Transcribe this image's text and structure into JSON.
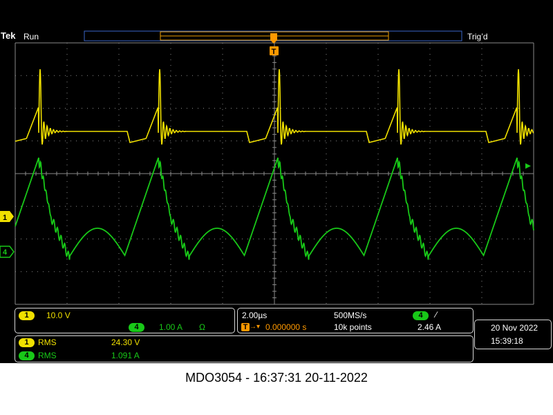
{
  "header": {
    "brand": "Tek",
    "state": "Run",
    "trigger_status": "Trig’d",
    "trigger_marker": "T"
  },
  "channels": {
    "ch1": {
      "number": "1",
      "color": "#f0e000"
    },
    "ch4": {
      "number": "4",
      "color": "#18c818"
    }
  },
  "readouts": {
    "ch1_scale": "10.0 V",
    "ch4_scale": "1.00 A",
    "ch4_unit_symbol": "Ω",
    "timebase": "2.00µs",
    "sample_rate": "500MS/s",
    "trigger_source": "4",
    "trigger_slope_symbol": "⁄",
    "trigger_delay": "0.000000 s",
    "record_length": "10k points",
    "trigger_level": "2.46 A",
    "delay_marker": "T",
    "delay_arrow": "→▾"
  },
  "measurements": [
    {
      "channel": "1",
      "name": "RMS",
      "value": "24.30 V"
    },
    {
      "channel": "4",
      "name": "RMS",
      "value": "1.091 A"
    }
  ],
  "datetime": {
    "date": "20 Nov 2022",
    "time": "15:39:18"
  },
  "caption": "MDO3054 - 16:37:31    20-11-2022",
  "colors": {
    "ch1": "#f0e000",
    "ch4": "#18c818",
    "grid": "#8a8a8a",
    "trigger": "#ff9900",
    "frame": "#3a66c8"
  }
}
